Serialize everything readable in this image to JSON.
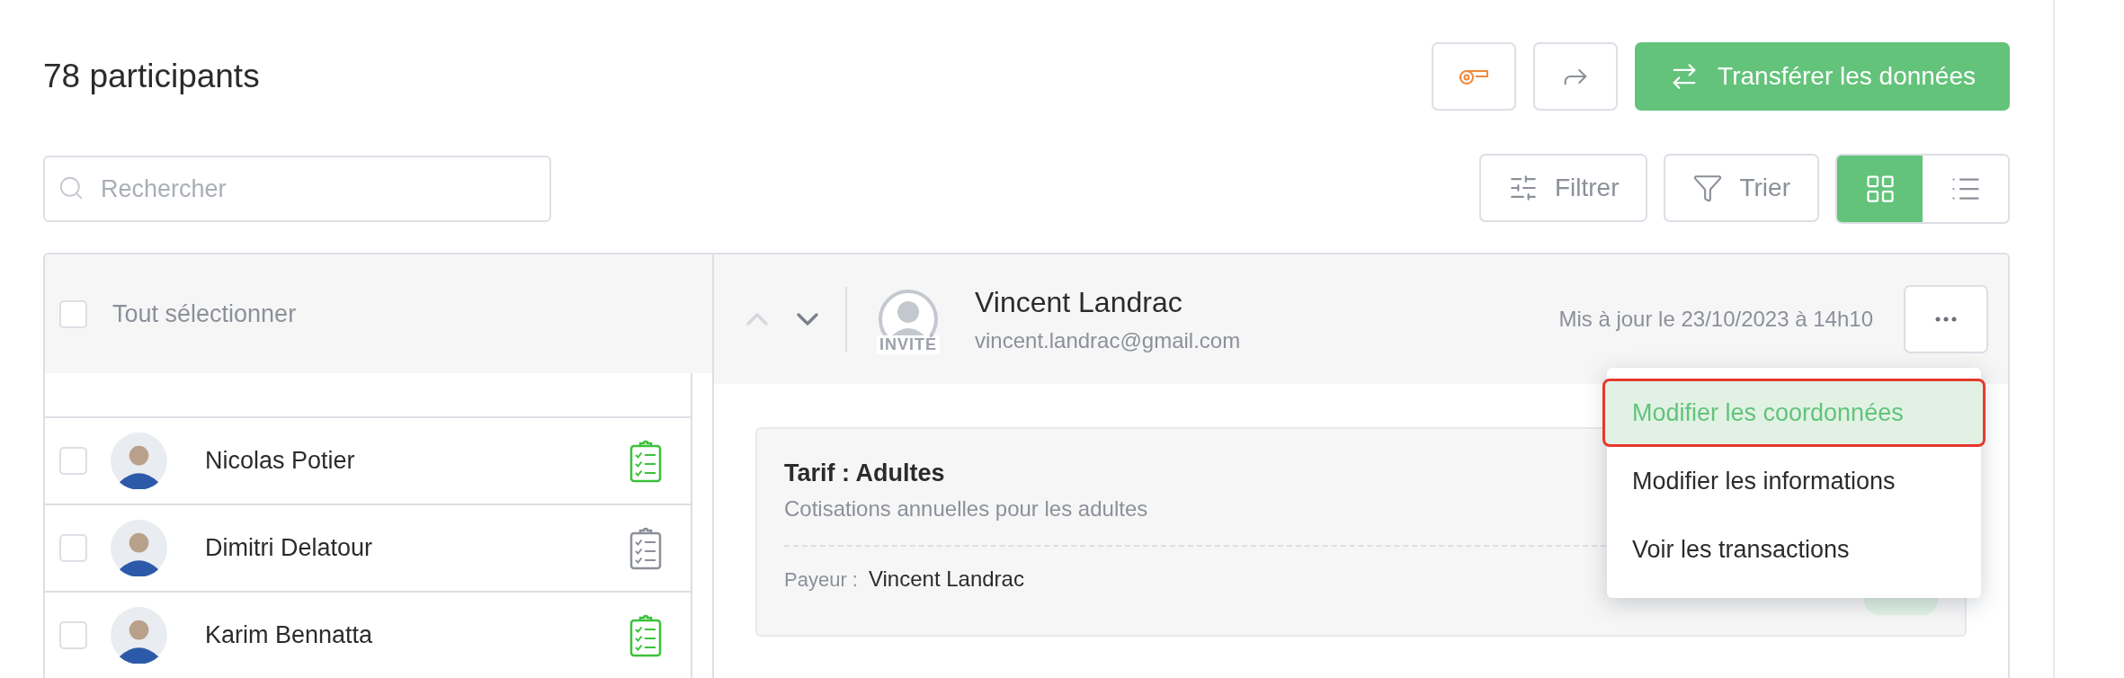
{
  "title": "78 participants",
  "toolbar": {
    "transfer_button": "Transférer les données",
    "search": {
      "placeholder": "Rechercher"
    },
    "filter_button": "Filtrer",
    "sort_button": "Trier",
    "views": [
      {
        "kind": "grid",
        "selected": true
      },
      {
        "kind": "list",
        "selected": false
      }
    ]
  },
  "list": {
    "select_all": {
      "label": "Tout sélectionner",
      "checked": false
    },
    "rows": [
      {
        "name": "Nicolas Potier",
        "checked": false,
        "form_complete": true
      },
      {
        "name": "Dimitri Delatour",
        "checked": false,
        "form_complete": false
      },
      {
        "name": "Karim Bennatta",
        "checked": false,
        "form_complete": true
      }
    ]
  },
  "detail": {
    "prev_disabled": true,
    "next_disabled": false,
    "badge": "INVITÉ",
    "name": "Vincent Landrac",
    "email": "vincent.landrac@gmail.com",
    "updated": "Mis à jour le 23/10/2023 à 14h10",
    "card": {
      "title": "Tarif : Adultes",
      "subtitle": "Cotisations annuelles pour les adultes",
      "payer_label": "Payeur :",
      "payer": "Vincent Landrac"
    },
    "menu": [
      {
        "label": "Modifier les coordonnées",
        "selected": true
      },
      {
        "label": "Modifier les informations",
        "selected": false
      },
      {
        "label": "Voir les transactions",
        "selected": false
      }
    ]
  }
}
